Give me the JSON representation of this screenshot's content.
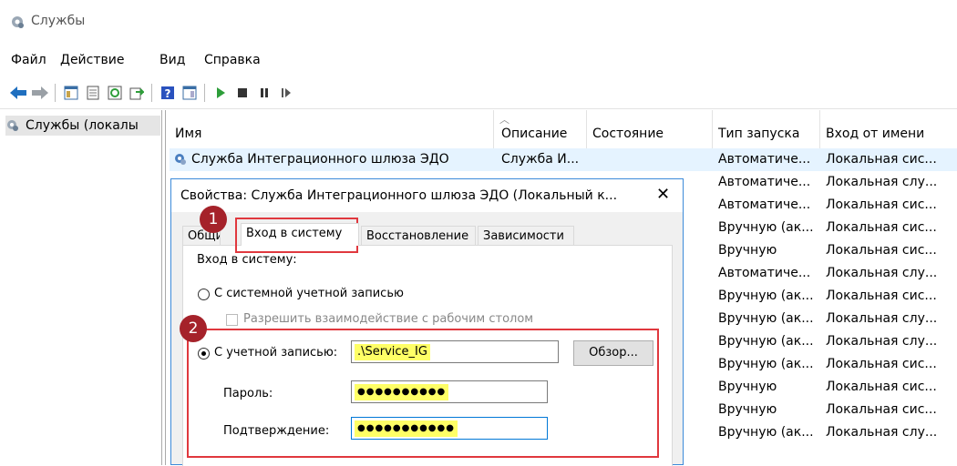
{
  "window": {
    "title": "Службы",
    "icon": "gear-icon"
  },
  "menu": [
    "Файл",
    "Действие",
    "Вид",
    "Справка"
  ],
  "toolbar": [
    "back-icon",
    "forward-icon",
    "console-tree-icon",
    "properties-icon",
    "refresh-icon",
    "export-icon",
    "help-icon",
    "view-icon",
    "play-icon",
    "stop-icon",
    "pause-icon",
    "resume-icon"
  ],
  "tree": {
    "node_label": "Службы (локалы"
  },
  "columns": [
    "Имя",
    "Описание",
    "Состояние",
    "Тип запуска",
    "Вход от имени"
  ],
  "rows": [
    {
      "name": "Служба Интеграционного шлюза ЭДО",
      "desc": "Служба И...",
      "state": "",
      "startup": "Автоматиче...",
      "logon": "Локальная сис..."
    },
    {
      "name": "",
      "desc": "",
      "state": "ся",
      "startup": "Автоматиче...",
      "logon": "Локальная слу..."
    },
    {
      "name": "",
      "desc": "",
      "state": "ся",
      "startup": "Автоматиче...",
      "logon": "Локальная сис..."
    },
    {
      "name": "",
      "desc": "",
      "state": "",
      "startup": "Вручную (ак...",
      "logon": "Локальная сис..."
    },
    {
      "name": "",
      "desc": "",
      "state": "ся",
      "startup": "Вручную",
      "logon": "Локальная сис..."
    },
    {
      "name": "",
      "desc": "",
      "state": "ся",
      "startup": "Автоматиче...",
      "logon": "Локальная слу..."
    },
    {
      "name": "",
      "desc": "",
      "state": "",
      "startup": "Вручную (ак...",
      "logon": "Локальная сис..."
    },
    {
      "name": "",
      "desc": "",
      "state": "",
      "startup": "Вручную (ак...",
      "logon": "Локальная слу..."
    },
    {
      "name": "",
      "desc": "",
      "state": "ся",
      "startup": "Вручную (ак...",
      "logon": "Локальная слу..."
    },
    {
      "name": "",
      "desc": "",
      "state": "",
      "startup": "Вручную (ак...",
      "logon": "Локальная сис..."
    },
    {
      "name": "",
      "desc": "",
      "state": "",
      "startup": "Вручную",
      "logon": "Локальная сис..."
    },
    {
      "name": "",
      "desc": "",
      "state": "",
      "startup": "Вручную",
      "logon": "Локальная сис..."
    },
    {
      "name": "",
      "desc": "",
      "state": "",
      "startup": "Вручную (ак...",
      "logon": "Локальная слу..."
    }
  ],
  "dialog": {
    "title": "Свойства: Служба Интеграционного шлюза ЭДО (Локальный к...",
    "close": "✕",
    "tabs": [
      "Общие",
      "Вход в систему",
      "Восстановление",
      "Зависимости"
    ],
    "active_tab": "Вход в систему",
    "section_label": "Вход в систему:",
    "radio_system": "С системной учетной записью",
    "checkbox_interact": "Разрешить взаимодействие с рабочим столом",
    "radio_account": "С учетной записью:",
    "account_value": ".\\Service_IG",
    "browse_button": "Обзор...",
    "password_label": "Пароль:",
    "password_value": "●●●●●●●●●●",
    "confirm_label": "Подтверждение:",
    "confirm_value": "●●●●●●●●●●●"
  },
  "annotations": {
    "badge1": "1",
    "badge2": "2",
    "colors": {
      "box": "#e0383e",
      "badge": "#a5222a",
      "highlight": "#ffff66"
    }
  }
}
